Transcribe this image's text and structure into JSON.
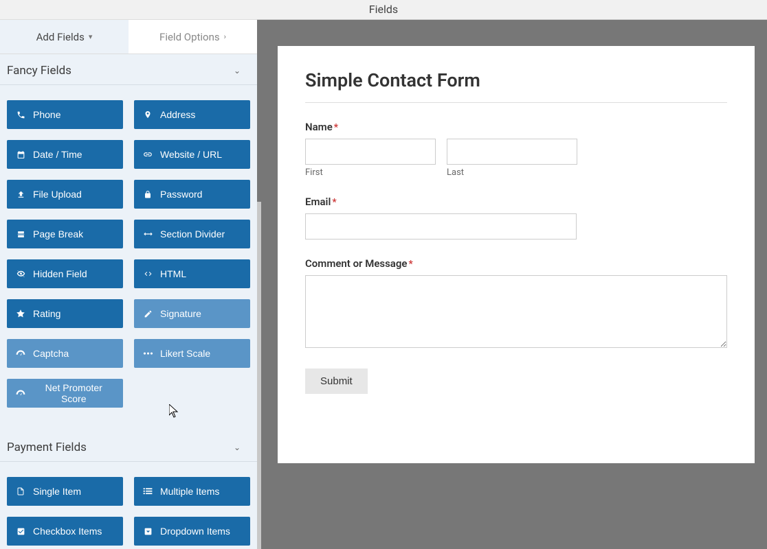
{
  "header": {
    "title": "Fields"
  },
  "tabs": {
    "add": "Add Fields",
    "options": "Field Options"
  },
  "sections": {
    "fancy": {
      "title": "Fancy Fields",
      "items": [
        {
          "label": "Phone",
          "icon": "phone-icon"
        },
        {
          "label": "Address",
          "icon": "pin-icon"
        },
        {
          "label": "Date / Time",
          "icon": "calendar-icon"
        },
        {
          "label": "Website / URL",
          "icon": "link-icon"
        },
        {
          "label": "File Upload",
          "icon": "upload-icon"
        },
        {
          "label": "Password",
          "icon": "lock-icon"
        },
        {
          "label": "Page Break",
          "icon": "page-break-icon"
        },
        {
          "label": "Section Divider",
          "icon": "arrows-h-icon"
        },
        {
          "label": "Hidden Field",
          "icon": "eye-off-icon"
        },
        {
          "label": "HTML",
          "icon": "code-icon"
        },
        {
          "label": "Rating",
          "icon": "star-icon"
        },
        {
          "label": "Signature",
          "icon": "pencil-icon",
          "light": true
        },
        {
          "label": "Captcha",
          "icon": "dashboard-icon",
          "light": true
        },
        {
          "label": "Likert Scale",
          "icon": "ellipsis-icon",
          "light": true
        },
        {
          "label": "Net Promoter Score",
          "icon": "tachometer-icon",
          "light": true
        }
      ]
    },
    "payment": {
      "title": "Payment Fields",
      "items": [
        {
          "label": "Single Item",
          "icon": "file-icon"
        },
        {
          "label": "Multiple Items",
          "icon": "list-icon"
        },
        {
          "label": "Checkbox Items",
          "icon": "check-square-icon"
        },
        {
          "label": "Dropdown Items",
          "icon": "dropdown-icon"
        }
      ]
    }
  },
  "form": {
    "title": "Simple Contact Form",
    "name_label": "Name",
    "first_label": "First",
    "last_label": "Last",
    "email_label": "Email",
    "comment_label": "Comment or Message",
    "submit_label": "Submit",
    "required_mark": "*"
  }
}
